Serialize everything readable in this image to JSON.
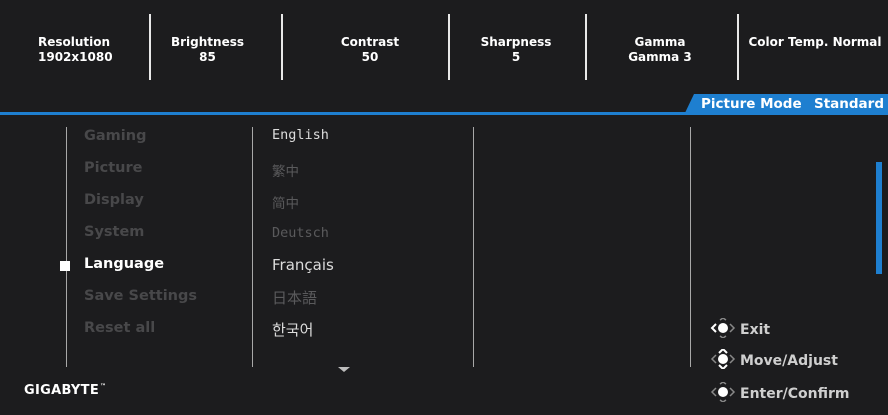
{
  "status_bar": {
    "items": [
      {
        "label": "Resolution",
        "value": "1902x1080"
      },
      {
        "label": "Brightness",
        "value": "85"
      },
      {
        "label": "Contrast",
        "value": "50"
      },
      {
        "label": "Sharpness",
        "value": "5"
      },
      {
        "label": "Gamma",
        "value": "Gamma 3"
      },
      {
        "label": "Color Temp. Normal",
        "value": ""
      }
    ]
  },
  "picture_mode": {
    "label": "Picture Mode",
    "value": "Standard"
  },
  "menu": {
    "items": [
      "Gaming",
      "Picture",
      "Display",
      "System",
      "Language",
      "Save Settings",
      "Reset all"
    ],
    "active": "Language"
  },
  "languages": {
    "items": [
      "English",
      "繁中",
      "简中",
      "Deutsch",
      "Français",
      "日本語",
      "한국어"
    ]
  },
  "hints": {
    "exit": "Exit",
    "move": "Move/Adjust",
    "enter": "Enter/Confirm"
  },
  "brand": {
    "logo": "GIGABYTE",
    "trademark": "™"
  },
  "colors": {
    "accent": "#1e7fd0",
    "background": "#1c1c1e"
  },
  "icons": {
    "nav": "joystick-icon",
    "scroll": "chevron-down-icon"
  }
}
